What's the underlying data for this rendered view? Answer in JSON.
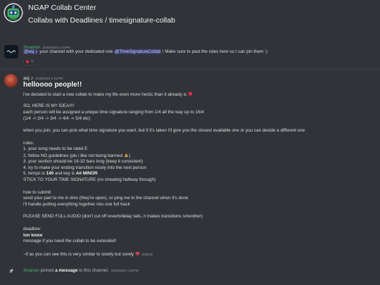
{
  "colors": {
    "background": "#313338",
    "text": "#dbdee1",
    "muted": "#949ba4",
    "author_green": "#4fb57a",
    "mention_text": "#c9cdfb",
    "heart_red": "#dd2e44"
  },
  "header": {
    "server_icon": "server-icon",
    "server_name": "NGAP Collab Center",
    "channel_path": "Collabs with Deadlines / timesignature-collab"
  },
  "messages": [
    {
      "author": "3manon",
      "timestamp": "3/28/2026 4:31PM",
      "mention_user": "@asj ♪",
      "text_1": " your channel with your dedicated role ",
      "mention_role": "@TimeSignatureCollab",
      "text_2": " ! Make sure to past the rules here so I can pin them :)",
      "reaction": {
        "emoji": "red-heart-emoji",
        "count": "1"
      }
    },
    {
      "author": "asj ♪",
      "timestamp": "3/28/2026 4:31PM",
      "heading": "helloooo people!!",
      "intro": {
        "text": "i've decided to start a new collab to make my life even more hectic than it already is",
        "emoji": "red-heart-emoji"
      },
      "idea": {
        "title": "SO, HERE IS MY IDEA!!!!",
        "description": "each person will be assigned a unique time signature ranging from 1/4 all the way up to 16/4",
        "example": "(1/4 -> 2/4 -> 3/4 -> 4/4 -> 5/4 etc)"
      },
      "join": "when you join, you can pick what time signature you want, but if it's taken i'll give you the closest available one or you can decide a different one",
      "rules": {
        "title": "rules:",
        "r1": "1. your song needs to be rated E",
        "r2": {
          "text": "2. follow NG guidelines (pls i like not being banned",
          "emoji": "folded-hands-emoji",
          "end": ")"
        },
        "r3": "3. your section should be 16-32 bars long (keep it consistent)",
        "r4": "4. try to make your ending transition nicely into the next person",
        "r5": {
          "pre": "5. tempo is ",
          "tempo": "140",
          "mid": " and key is ",
          "key": "A# MINOR"
        },
        "stick": "STICK TO YOUR TIME SIGNATURE (no cheating halfway through)"
      },
      "submit": {
        "title": "how to submit:",
        "line_1": "send your part to me in dms (they're open), or ping me in the channel when it's done",
        "line_2": "i'll handle putting everything together into one full track"
      },
      "audio_note": "PLEASE SEND FULL AUDIO (don't cut off reverb/delay tails, it makes transitions smoother)",
      "deadline": {
        "title": "deadline:",
        "value": "ion know",
        "note": "message if you need the collab to be extended!"
      },
      "closing": {
        "text": "~if as you can see this is very similar to slowly but surely",
        "emoji": "broken-heart-emoji",
        "edited": "(edited)"
      }
    }
  ],
  "system_message": {
    "icon": "pin-icon",
    "actor": "3manon",
    "action": " pinned ",
    "link": "a message",
    "rest": " to this channel.",
    "timestamp": "3/28/2026 4:31PM"
  }
}
